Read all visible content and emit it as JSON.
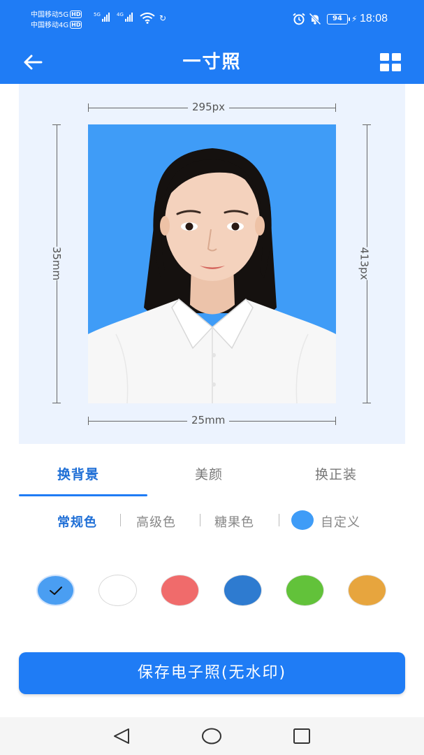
{
  "status_bar": {
    "carrier_1": "中国移动5G",
    "carrier_2": "中国移动4G",
    "hd_badge": "HD",
    "signal_1_label": "5G",
    "signal_2_label": "4G",
    "battery": "94",
    "time": "18:08",
    "icons": [
      "wifi-icon",
      "sync-icon",
      "alarm-icon",
      "mute-icon",
      "bolt-icon"
    ]
  },
  "header": {
    "title": "一寸照",
    "back_icon": "arrow-left-icon",
    "menu_icon": "grid-icon"
  },
  "preview": {
    "width_px": "295px",
    "width_mm": "25mm",
    "height_mm": "35mm",
    "height_px": "413px",
    "background_color": "#3f9cf7"
  },
  "tabs": [
    {
      "label": "换背景",
      "active": true
    },
    {
      "label": "美颜",
      "active": false
    },
    {
      "label": "换正装",
      "active": false
    }
  ],
  "subcategories": [
    {
      "label": "常规色",
      "active": true
    },
    {
      "label": "高级色",
      "active": false
    },
    {
      "label": "糖果色",
      "active": false
    },
    {
      "label": "自定义",
      "active": false
    }
  ],
  "swatches": [
    {
      "color": "#4a9ef2",
      "selected": true
    },
    {
      "color": "#ffffff",
      "selected": false
    },
    {
      "color": "#f06b6b",
      "selected": false
    },
    {
      "color": "#2e7bd0",
      "selected": false
    },
    {
      "color": "#62c23a",
      "selected": false
    },
    {
      "color": "#e7a53e",
      "selected": false
    }
  ],
  "save_button": "保存电子照(无水印)",
  "nav": [
    "back-triangle-icon",
    "home-circle-icon",
    "recents-square-icon"
  ],
  "colors": {
    "primary": "#1f7cf5",
    "accent_text": "#1f6fd6",
    "preview_bg": "#ecf3fe"
  }
}
